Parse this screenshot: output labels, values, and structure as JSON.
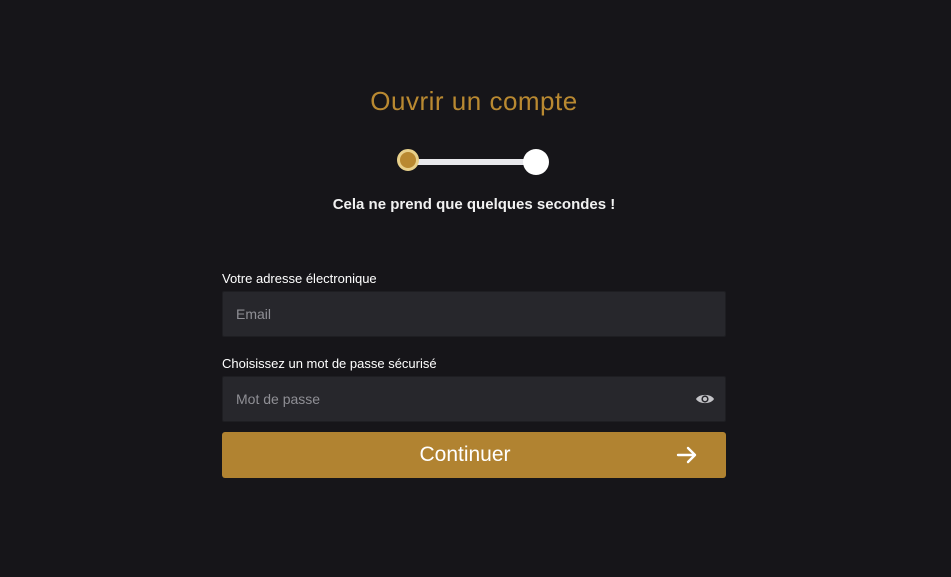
{
  "page": {
    "title": "Ouvrir un compte",
    "subtitle": "Cela ne prend que quelques secondes !"
  },
  "stepper": {
    "current_step": 1,
    "total_steps": 2
  },
  "form": {
    "email": {
      "label": "Votre adresse électronique",
      "placeholder": "Email",
      "value": ""
    },
    "password": {
      "label": "Choisissez un mot de passe sécurisé",
      "placeholder": "Mot de passe",
      "value": "",
      "toggle_icon": "eye-icon"
    },
    "submit": {
      "label": "Continuer",
      "icon": "arrow-right-icon"
    }
  },
  "colors": {
    "background": "#161519",
    "accent": "#b18331",
    "title": "#b98931",
    "input_bg": "#27272c"
  }
}
